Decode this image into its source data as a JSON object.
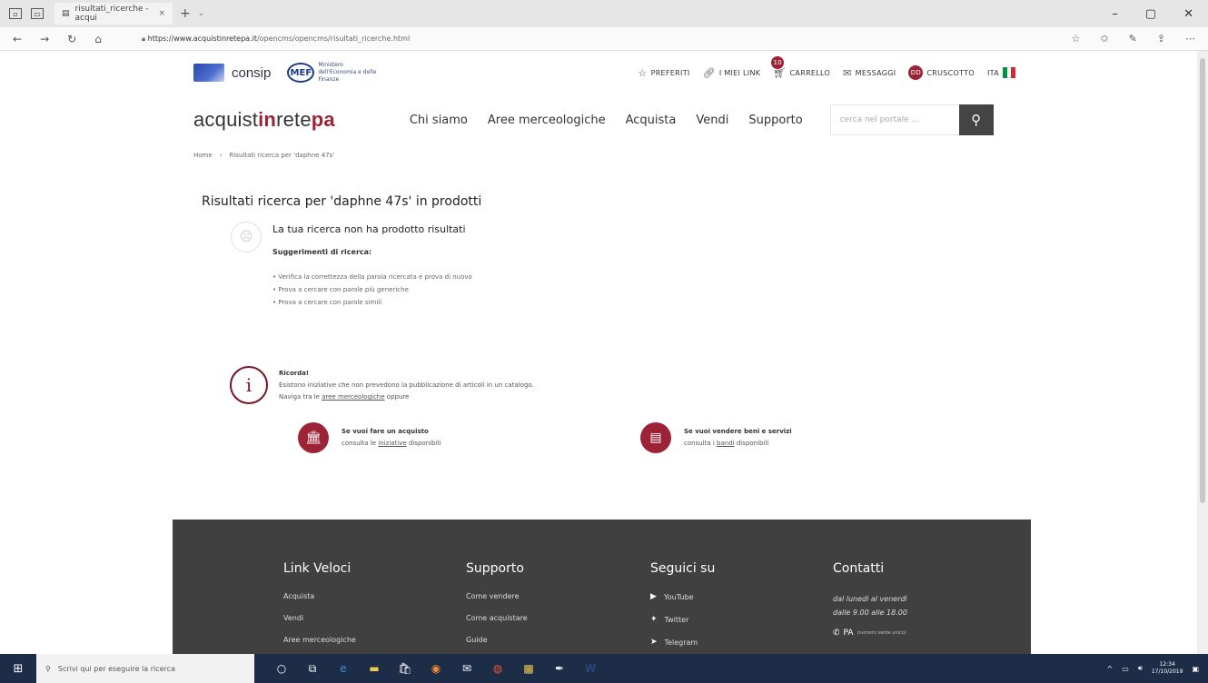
{
  "browser": {
    "tab_title": "risultati_ricerche - acqui",
    "tab_close": "×",
    "new_tab": "+",
    "tab_menu": "⌄",
    "url_host": "https://www.acquistinretepa.it",
    "url_path": "/opencms/opencms/risultati_ricerche.html",
    "win_min": "–",
    "win_max": "▢",
    "win_close": "✕"
  },
  "header": {
    "consip_label": "consip",
    "mef_abbrev": "MEF",
    "mef_line1": "Ministero",
    "mef_line2": "dell'Economia e delle Finanze",
    "links": {
      "preferiti": "PREFERITI",
      "miei_link": "I MIEI LINK",
      "carrello": "CARRELLO",
      "cart_count": "10",
      "messaggi": "MESSAGGI",
      "avatar": "DD",
      "cruscotto": "CRUSCOTTO",
      "lang": "ITA"
    },
    "flag_colors": [
      "#009246",
      "#ffffff",
      "#ce2b37"
    ]
  },
  "nav": {
    "brand_pre": "acquist",
    "brand_in": "in",
    "brand_rete": "rete",
    "brand_pa": "pa",
    "items": [
      "Chi siamo",
      "Aree merceologiche",
      "Acquista",
      "Vendi",
      "Supporto"
    ],
    "search_placeholder": "cerca nel portale ..."
  },
  "breadcrumb": {
    "home": "Home",
    "sep": "›",
    "current": "Risultati ricerca per 'daphne 47s'"
  },
  "results": {
    "title": "Risultati ricerca per 'daphne 47s' in prodotti",
    "no_result": "La tua ricerca non ha prodotto risultati",
    "suggestions_title": "Suggerimenti di ricerca:",
    "suggestions": [
      "• Verifica la correttezza della parola ricercata e prova di nuovo",
      "• Prova a cercare con parole più generiche",
      "• Prova a cercare con parole simili"
    ]
  },
  "reminder": {
    "title": "Ricorda!",
    "line1": "Esistono iniziative che non prevedono la pubblicazione di articoli in un catalogo.",
    "line2_pre": "Naviga tra le",
    "line2_link": "aree merceologiche",
    "line2_post": "oppure"
  },
  "actions": {
    "buy_title": "Se vuoi fare un acquisto",
    "buy_pre": "consulta le",
    "buy_link": "iniziative",
    "buy_post": "disponibili",
    "sell_title": "Se vuoi vendere beni e servizi",
    "sell_pre": "consulta i",
    "sell_link": "bandi",
    "sell_post": "disponibili"
  },
  "footer": {
    "col1_title": "Link Veloci",
    "col1_items": [
      "Acquista",
      "Vendi",
      "Aree merceologiche"
    ],
    "col2_title": "Supporto",
    "col2_items": [
      "Come vendere",
      "Come acquistare",
      "Guide"
    ],
    "col3_title": "Seguici su",
    "col3_items": [
      "YouTube",
      "Twitter",
      "Telegram"
    ],
    "col4_title": "Contatti",
    "hours1": "dal lunedì al venerdì",
    "hours2": "dalle 9.00 alle 18.00",
    "pa_label": "PA",
    "pa_small": "(numero verde unico)"
  },
  "taskbar": {
    "search_placeholder": "Scrivi qui per eseguire la ricerca",
    "time": "12:34",
    "date": "17/10/2019"
  }
}
